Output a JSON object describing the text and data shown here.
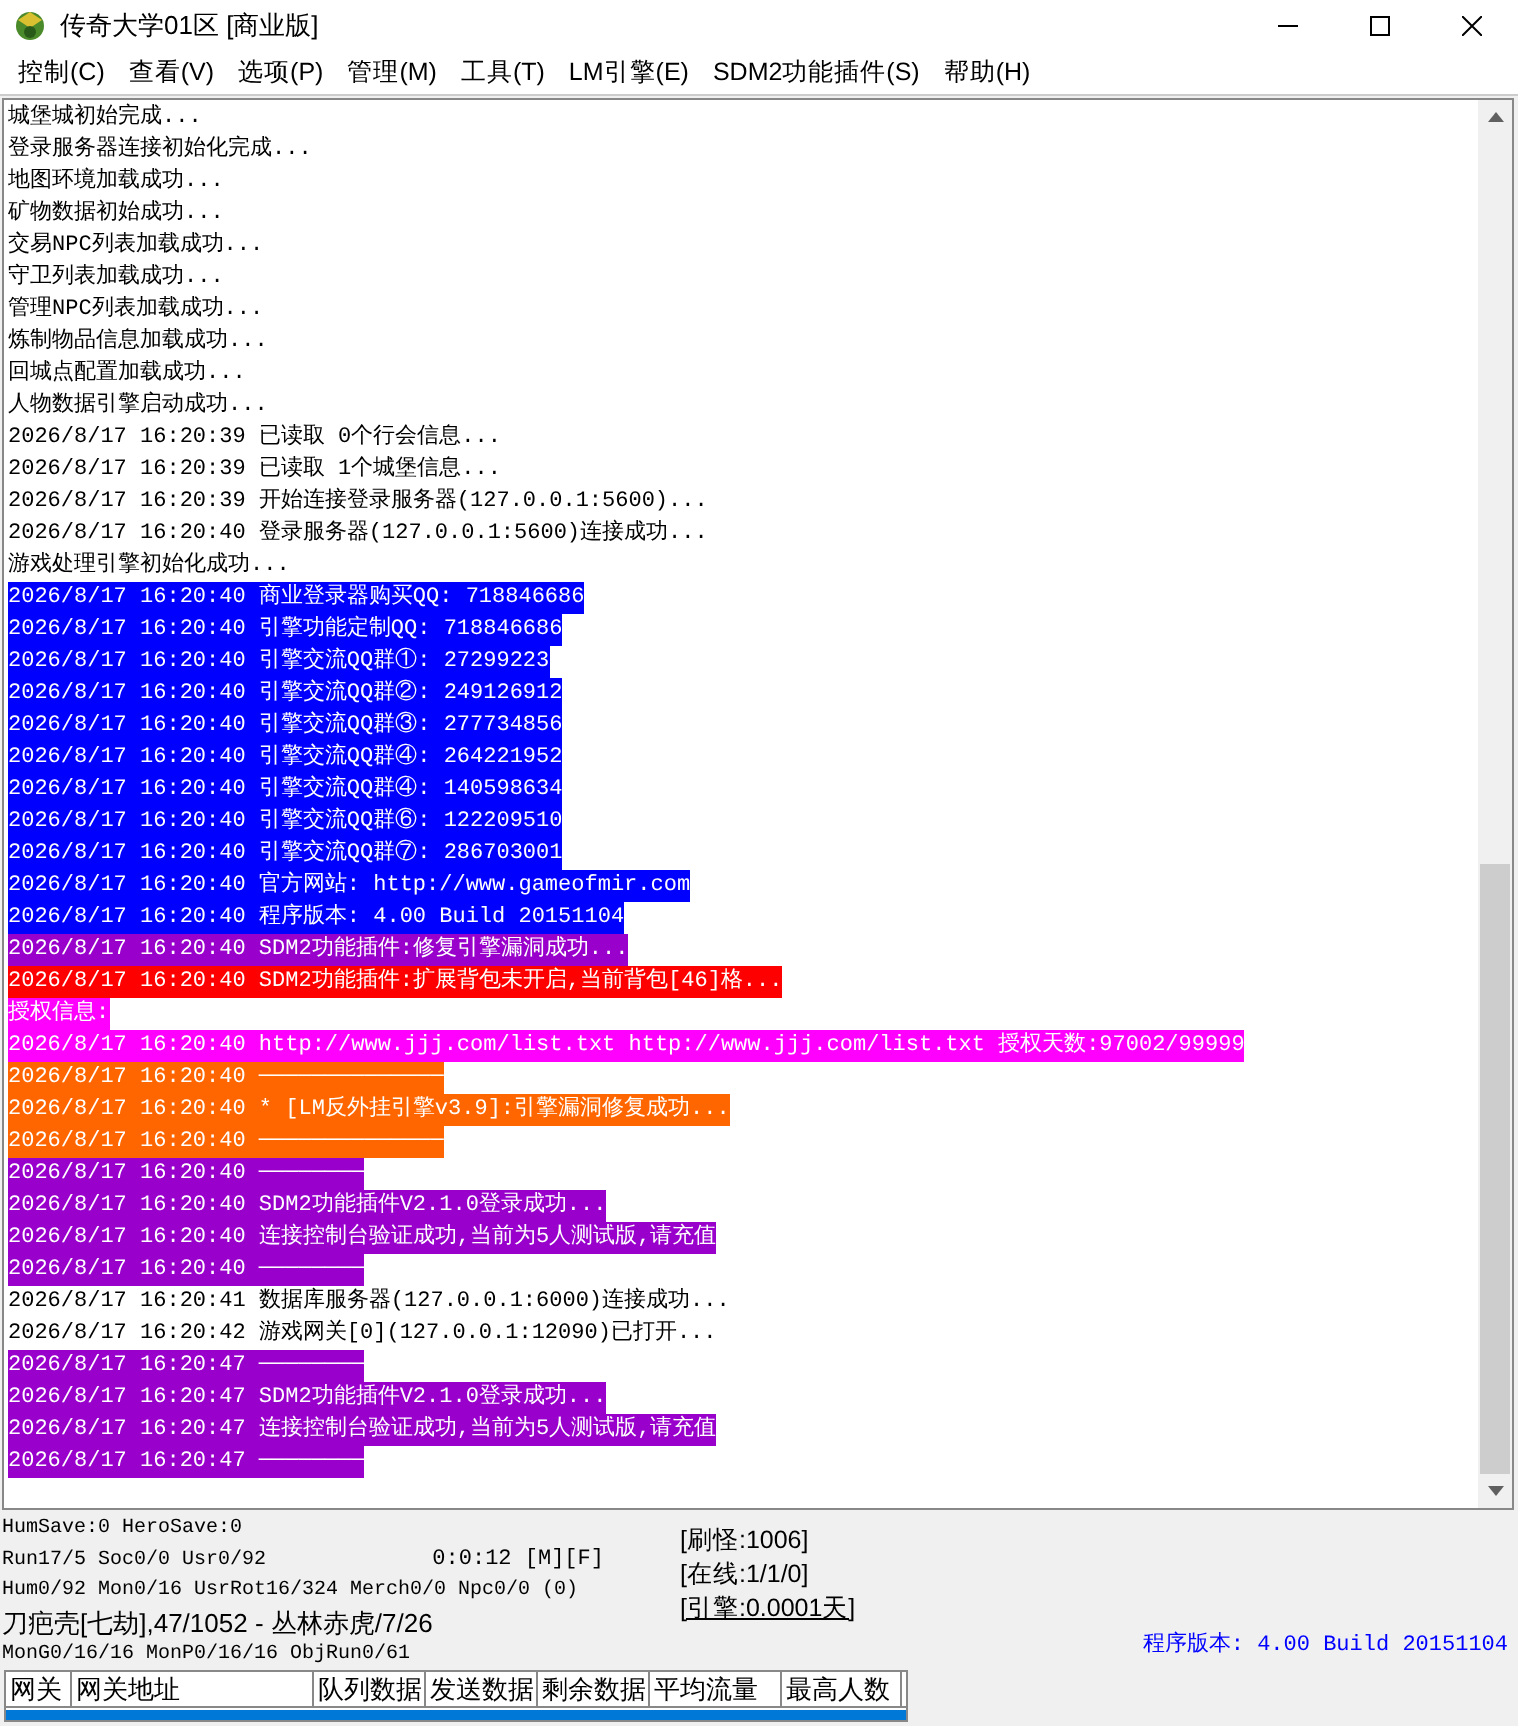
{
  "window": {
    "title": "传奇大学01区 [商业版]"
  },
  "menu": [
    "控制(C)",
    "查看(V)",
    "选项(P)",
    "管理(M)",
    "工具(T)",
    "LM引擎(E)",
    "SDM2功能插件(S)",
    "帮助(H)"
  ],
  "log": [
    {
      "text": "城堡城初始完成..."
    },
    {
      "text": "登录服务器连接初始化完成..."
    },
    {
      "text": "地图环境加载成功..."
    },
    {
      "text": "矿物数据初始成功..."
    },
    {
      "text": "交易NPC列表加载成功..."
    },
    {
      "text": "守卫列表加载成功..."
    },
    {
      "text": "管理NPC列表加载成功..."
    },
    {
      "text": "炼制物品信息加载成功..."
    },
    {
      "text": "回城点配置加载成功..."
    },
    {
      "text": "人物数据引擎启动成功..."
    },
    {
      "text": "2026/8/17 16:20:39 已读取 0个行会信息..."
    },
    {
      "text": "2026/8/17 16:20:39 已读取 1个城堡信息..."
    },
    {
      "text": "2026/8/17 16:20:39 开始连接登录服务器(127.0.0.1:5600)..."
    },
    {
      "text": "2026/8/17 16:20:40 登录服务器(127.0.0.1:5600)连接成功..."
    },
    {
      "text": "游戏处理引擎初始化成功..."
    },
    {
      "text": "2026/8/17 16:20:40 商业登录器购买QQ: 718846686",
      "color": "#0000ff"
    },
    {
      "text": "2026/8/17 16:20:40 引擎功能定制QQ: 718846686",
      "color": "#0000ff"
    },
    {
      "text": "2026/8/17 16:20:40 引擎交流QQ群①: 27299223",
      "color": "#0000ff"
    },
    {
      "text": "2026/8/17 16:20:40 引擎交流QQ群②: 249126912",
      "color": "#0000ff"
    },
    {
      "text": "2026/8/17 16:20:40 引擎交流QQ群③: 277734856",
      "color": "#0000ff"
    },
    {
      "text": "2026/8/17 16:20:40 引擎交流QQ群④: 264221952",
      "color": "#0000ff"
    },
    {
      "text": "2026/8/17 16:20:40 引擎交流QQ群④: 140598634",
      "color": "#0000ff"
    },
    {
      "text": "2026/8/17 16:20:40 引擎交流QQ群⑥: 122209510",
      "color": "#0000ff"
    },
    {
      "text": "2026/8/17 16:20:40 引擎交流QQ群⑦: 286703001",
      "color": "#0000ff"
    },
    {
      "text": "2026/8/17 16:20:40 官方网站: http://www.gameofmir.com",
      "color": "#0000ff"
    },
    {
      "text": "2026/8/17 16:20:40 程序版本: 4.00 Build 20151104",
      "color": "#0000ff"
    },
    {
      "text": "2026/8/17 16:20:40 SDM2功能插件:修复引擎漏洞成功...",
      "color": "#9900cc"
    },
    {
      "text": "2026/8/17 16:20:40 SDM2功能插件:扩展背包未开启,当前背包[46]格...",
      "color": "#ff0000"
    },
    {
      "text": "授权信息:",
      "color": "#ff00ff"
    },
    {
      "text": "2026/8/17 16:20:40 http://www.jjj.com/list.txt http://www.jjj.com/list.txt 授权天数:97002/99999",
      "color": "#ff00ff"
    },
    {
      "text": "2026/8/17 16:20:40 ──────────────",
      "color": "#ff6600"
    },
    {
      "text": "2026/8/17 16:20:40 * [LM反外挂引擎v3.9]:引擎漏洞修复成功...",
      "color": "#ff6600"
    },
    {
      "text": "2026/8/17 16:20:40 ──────────────",
      "color": "#ff6600"
    },
    {
      "text": "2026/8/17 16:20:40 ────────",
      "color": "#9900cc"
    },
    {
      "text": "2026/8/17 16:20:40 SDM2功能插件V2.1.0登录成功...",
      "color": "#9900cc"
    },
    {
      "text": "2026/8/17 16:20:40 连接控制台验证成功,当前为5人测试版,请充值",
      "color": "#9900cc"
    },
    {
      "text": "2026/8/17 16:20:40 ────────",
      "color": "#9900cc"
    },
    {
      "text": "2026/8/17 16:20:41 数据库服务器(127.0.0.1:6000)连接成功..."
    },
    {
      "text": "2026/8/17 16:20:42 游戏网关[0](127.0.0.1:12090)已打开..."
    },
    {
      "text": "2026/8/17 16:20:47 ────────",
      "color": "#9900cc"
    },
    {
      "text": "2026/8/17 16:20:47 SDM2功能插件V2.1.0登录成功...",
      "color": "#9900cc"
    },
    {
      "text": "2026/8/17 16:20:47 连接控制台验证成功,当前为5人测试版,请充值",
      "color": "#9900cc"
    },
    {
      "text": "2026/8/17 16:20:47 ────────",
      "color": "#9900cc"
    }
  ],
  "status": {
    "lines": [
      "HumSave:0 HeroSave:0",
      "Run17/5 Soc0/0 Usr0/92",
      "Hum0/92 Mon0/16 UsrRot16/324 Merch0/0 Npc0/0 (0)",
      "刀疤壳[七劫],47/1052 - 丛林赤虎/7/26",
      "MonG0/16/16 MonP0/16/16 ObjRun0/61"
    ],
    "timer": "0:0:12 [M][F]",
    "counters": [
      {
        "text": "[刷怪:1006]",
        "link": false
      },
      {
        "text": "[在线:1/1/0]",
        "link": false
      },
      {
        "text": "[引擎:0.0001天]",
        "link": true
      }
    ],
    "version": "程序版本: 4.00 Build 20151104"
  },
  "table": {
    "columns": [
      "网关",
      "网关地址",
      "队列数据",
      "发送数据",
      "剩余数据",
      "平均流量",
      "最高人数"
    ]
  }
}
